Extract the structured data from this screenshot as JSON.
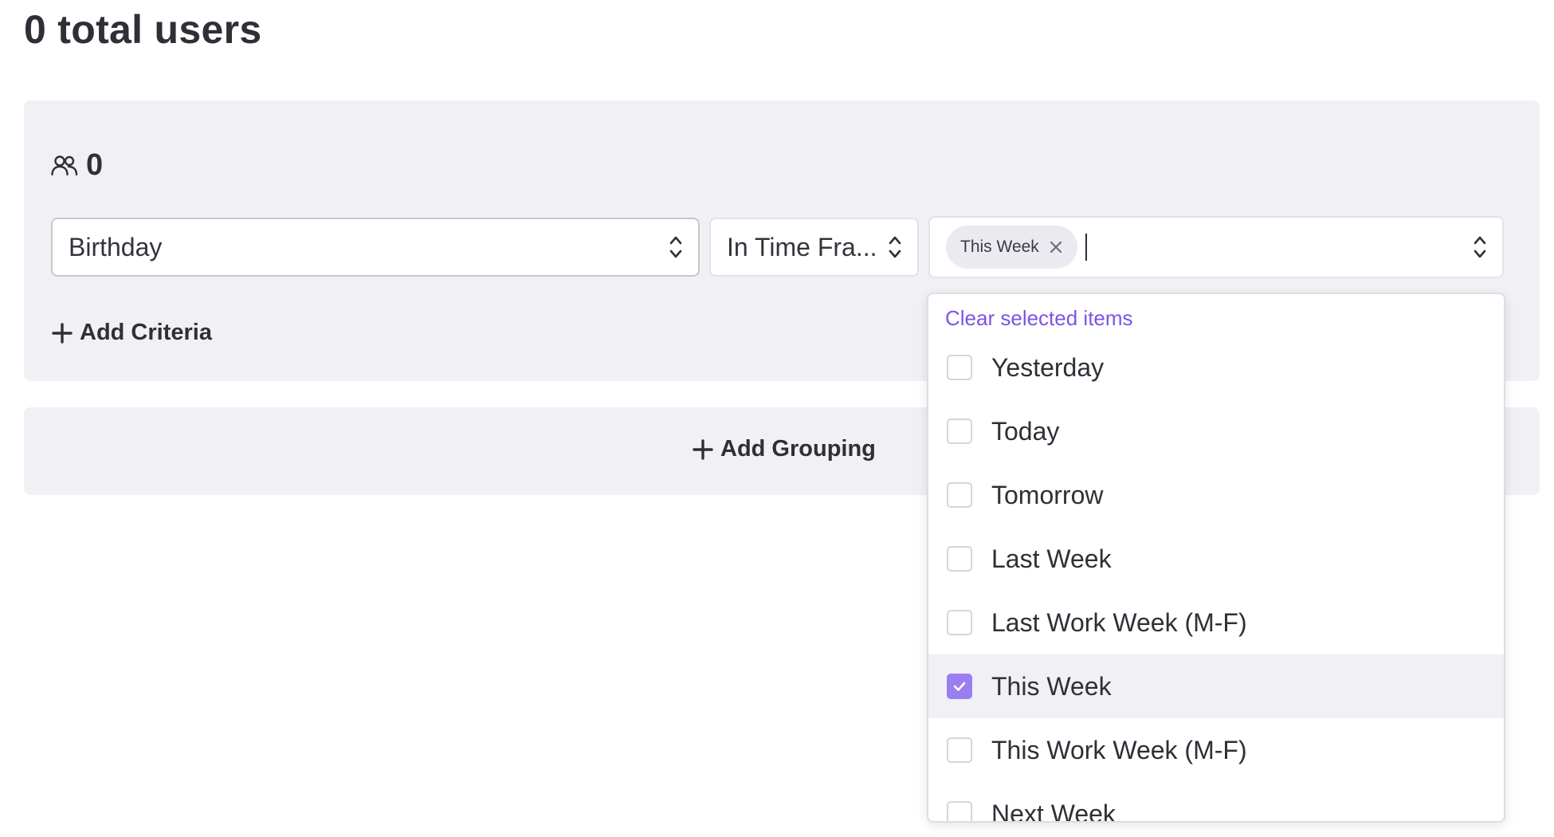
{
  "header": {
    "title": "0 total users"
  },
  "criteria": {
    "count": "0",
    "field_select": {
      "value": "Birthday"
    },
    "operator_select": {
      "value": "In Time Fra..."
    },
    "values_select": {
      "chips": [
        "This Week"
      ]
    },
    "add_criteria_label": "Add Criteria"
  },
  "grouping": {
    "add_grouping_label": "Add Grouping"
  },
  "dropdown": {
    "clear_label": "Clear selected items",
    "options": [
      {
        "label": "Yesterday",
        "checked": false
      },
      {
        "label": "Today",
        "checked": false
      },
      {
        "label": "Tomorrow",
        "checked": false
      },
      {
        "label": "Last Week",
        "checked": false
      },
      {
        "label": "Last Work Week (M-F)",
        "checked": false
      },
      {
        "label": "This Week",
        "checked": true
      },
      {
        "label": "This Work Week (M-F)",
        "checked": false
      },
      {
        "label": "Next Week",
        "checked": false
      }
    ]
  },
  "colors": {
    "accent": "#7a54e6",
    "checkbox_checked": "#9b7ef0",
    "panel_bg": "#f1f0f5"
  }
}
